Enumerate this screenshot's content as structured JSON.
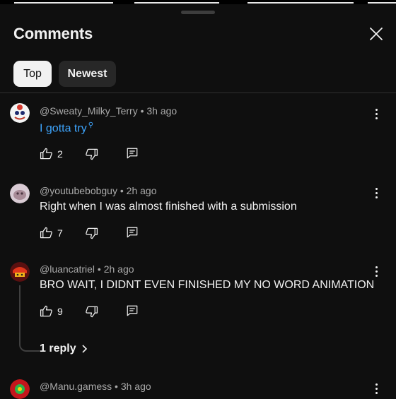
{
  "panel": {
    "title": "Comments"
  },
  "filters": {
    "top": "Top",
    "newest": "Newest"
  },
  "comments": [
    {
      "author": "@Sweaty_Milky_Terry",
      "time": "3h ago",
      "text": "I gotta try",
      "likes": "2"
    },
    {
      "author": "@youtubebobguy",
      "time": "2h ago",
      "text": "Right when I was almost finished with a submission",
      "likes": "7"
    },
    {
      "author": "@luancatriel",
      "time": "2h ago",
      "text": "BRO WAIT, I DIDNT EVEN FINISHED MY NO WORD ANIMATION",
      "likes": "9",
      "replies": "1 reply"
    },
    {
      "author": "@Manu.gamess",
      "time": "3h ago"
    }
  ],
  "separator": "•",
  "colors": {
    "background": "#0f0f0f",
    "link": "#3ea6ff",
    "meta": "#aaaaaa"
  }
}
